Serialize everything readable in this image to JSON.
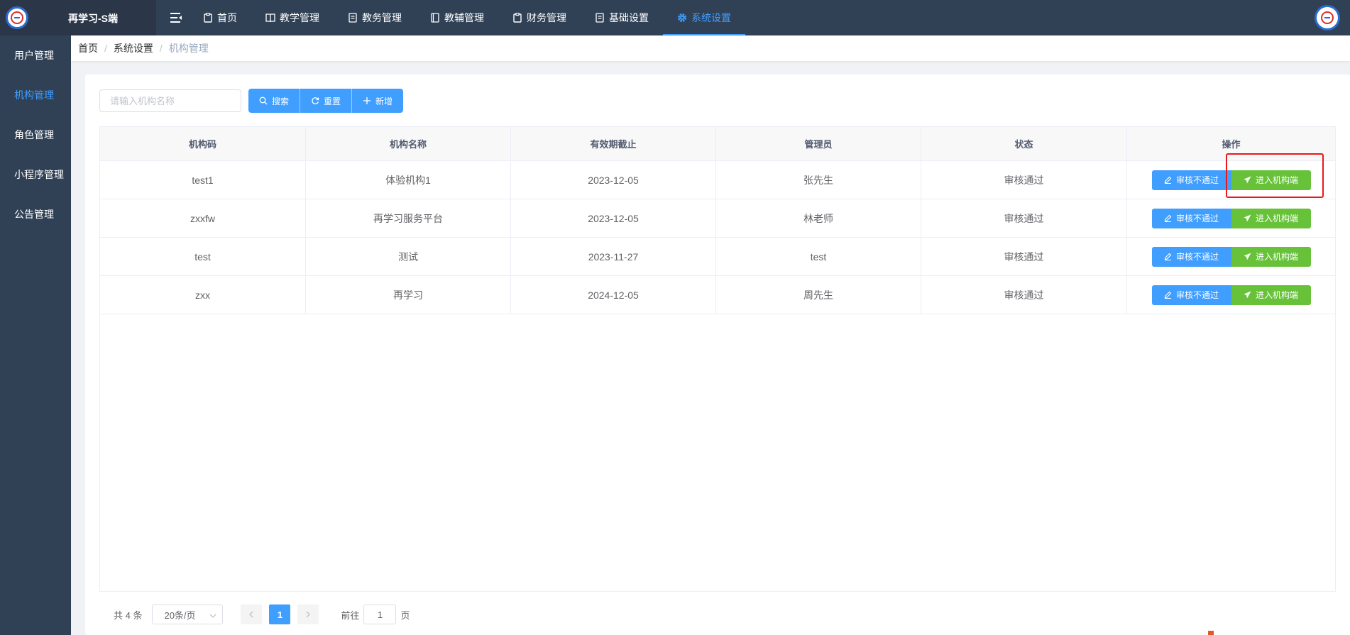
{
  "app": {
    "title": "再学习-S端"
  },
  "nav": {
    "items": [
      {
        "label": "首页",
        "icon": "clipboard-icon"
      },
      {
        "label": "教学管理",
        "icon": "book-icon"
      },
      {
        "label": "教务管理",
        "icon": "document-icon"
      },
      {
        "label": "教辅管理",
        "icon": "notebook-icon"
      },
      {
        "label": "财务管理",
        "icon": "clipboard-icon"
      },
      {
        "label": "基础设置",
        "icon": "document-icon"
      },
      {
        "label": "系统设置",
        "icon": "gear-icon",
        "active": true
      }
    ]
  },
  "sidebar": {
    "items": [
      {
        "label": "用户管理"
      },
      {
        "label": "机构管理",
        "active": true
      },
      {
        "label": "角色管理"
      },
      {
        "label": "小程序管理"
      },
      {
        "label": "公告管理"
      }
    ]
  },
  "breadcrumb": {
    "items": [
      "首页",
      "系统设置",
      "机构管理"
    ],
    "separator": "/"
  },
  "search": {
    "placeholder": "请输入机构名称",
    "value": ""
  },
  "toolbar": {
    "search_label": "搜索",
    "reset_label": "重置",
    "add_label": "新增"
  },
  "table": {
    "headers": [
      "机构码",
      "机构名称",
      "有效期截止",
      "管理员",
      "状态",
      "操作"
    ],
    "rows": [
      {
        "code": "test1",
        "name": "体验机构1",
        "expiry": "2023-12-05",
        "admin": "张先生",
        "status": "审核通过"
      },
      {
        "code": "zxxfw",
        "name": "再学习服务平台",
        "expiry": "2023-12-05",
        "admin": "林老师",
        "status": "审核通过"
      },
      {
        "code": "test",
        "name": "测试",
        "expiry": "2023-11-27",
        "admin": "test",
        "status": "审核通过"
      },
      {
        "code": "zxx",
        "name": "再学习",
        "expiry": "2024-12-05",
        "admin": "周先生",
        "status": "审核通过"
      }
    ],
    "actions": {
      "reject_label": "审核不通过",
      "enter_label": "进入机构端"
    }
  },
  "pagination": {
    "total_text": "共 4 条",
    "page_size": "20条/页",
    "current_page": "1",
    "goto_prefix": "前往",
    "goto_value": "1",
    "goto_suffix": "页"
  },
  "colors": {
    "header_bg": "#304156",
    "primary": "#409eff",
    "success": "#67c23a",
    "highlight": "#e8191c"
  }
}
